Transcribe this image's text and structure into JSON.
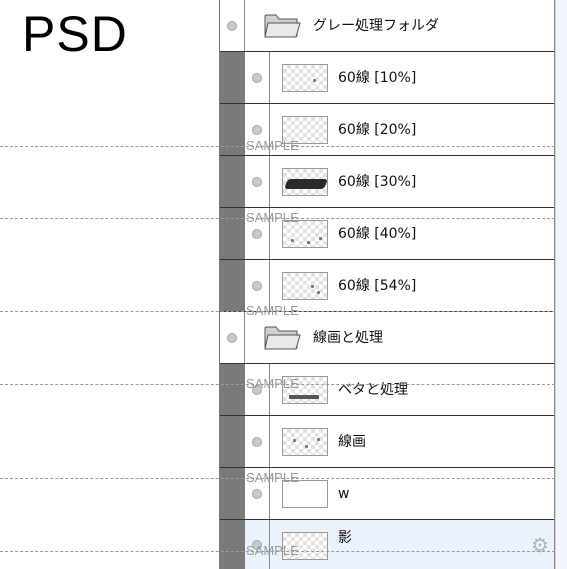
{
  "doc_label": "PSD",
  "watermark": "SAMPLE",
  "layers": [
    {
      "name": "グレー処理フォルダ",
      "type": "folder",
      "indented": false,
      "thumb": "folder-icon"
    },
    {
      "name": "60線 [10%]",
      "type": "layer",
      "indented": true,
      "thumb": "light"
    },
    {
      "name": "60線 [20%]",
      "type": "layer",
      "indented": true,
      "thumb": "light"
    },
    {
      "name": "60線 [30%]",
      "type": "layer",
      "indented": true,
      "thumb": "dark"
    },
    {
      "name": "60線 [40%]",
      "type": "layer",
      "indented": true,
      "thumb": "light"
    },
    {
      "name": "60線 [54%]",
      "type": "layer",
      "indented": true,
      "thumb": "light"
    },
    {
      "name": "線画と処理",
      "type": "folder",
      "indented": false,
      "thumb": "folder-icon"
    },
    {
      "name": "ベタと処理",
      "type": "layer",
      "indented": true,
      "thumb": "light"
    },
    {
      "name": "線画",
      "type": "layer",
      "indented": true,
      "thumb": "light"
    },
    {
      "name": "w",
      "type": "layer",
      "indented": true,
      "thumb": "light"
    },
    {
      "name": "影",
      "type": "layer",
      "indented": true,
      "thumb": "light",
      "selected": true,
      "settings_icon": "gear-icon"
    }
  ],
  "colors": {
    "indent_bar": "#7a7a7a",
    "selected_row": "#eaf3fb",
    "scroll_track": "#f0f6fb"
  }
}
